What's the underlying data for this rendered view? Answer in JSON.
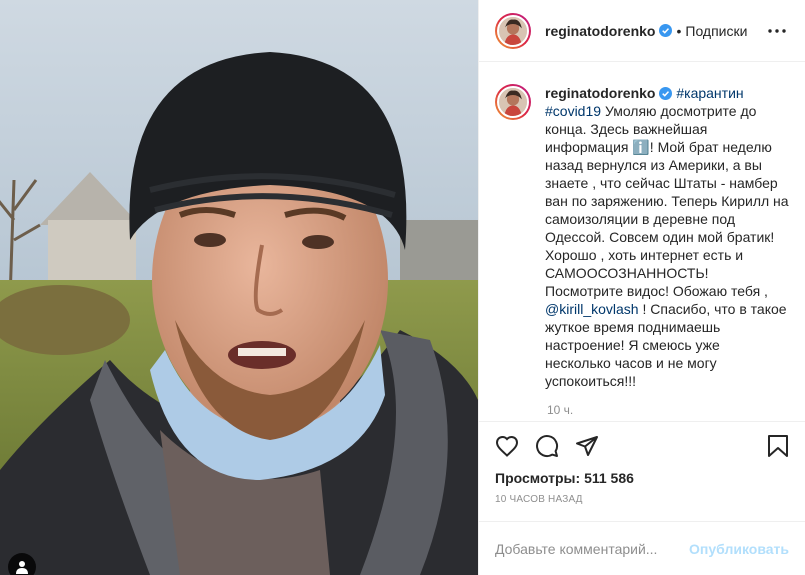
{
  "post": {
    "username": "reginatodorenko",
    "separator": "•",
    "follow_label": "Подписки",
    "caption": {
      "hashtags": [
        "#карантин",
        "#covid19"
      ],
      "text_before_mention": "Умоляю досмотрите до конца. Здесь важнейшая информация ℹ️! Мой брат неделю назад вернулся из Америки, а вы знаете , что сейчас Штаты - намбер ван по заряжению. Теперь Кирилл на самоизоляции в деревне под Одессой. Совсем один мой братик! Хорошо , хоть интернет есть и САМООСОЗНАННОСТЬ! Посмотрите видос! Обожаю тебя , ",
      "mention": "@kirill_kovlash",
      "text_after_mention": " ! Спасибо, что в такое жуткое время поднимаешь настроение! Я смеюсь уже несколько часов и не могу успокоиться!!!"
    },
    "caption_time": "10 ч.",
    "views_label": "Просмотры:",
    "views_count": "511 586",
    "time_ago": "10 часов назад",
    "comment_placeholder": "Добавьте комментарий...",
    "publish_label": "Опубликовать",
    "verified_color": "#3897f0",
    "link_color": "#00376b",
    "publish_color": "#b2dffc"
  }
}
